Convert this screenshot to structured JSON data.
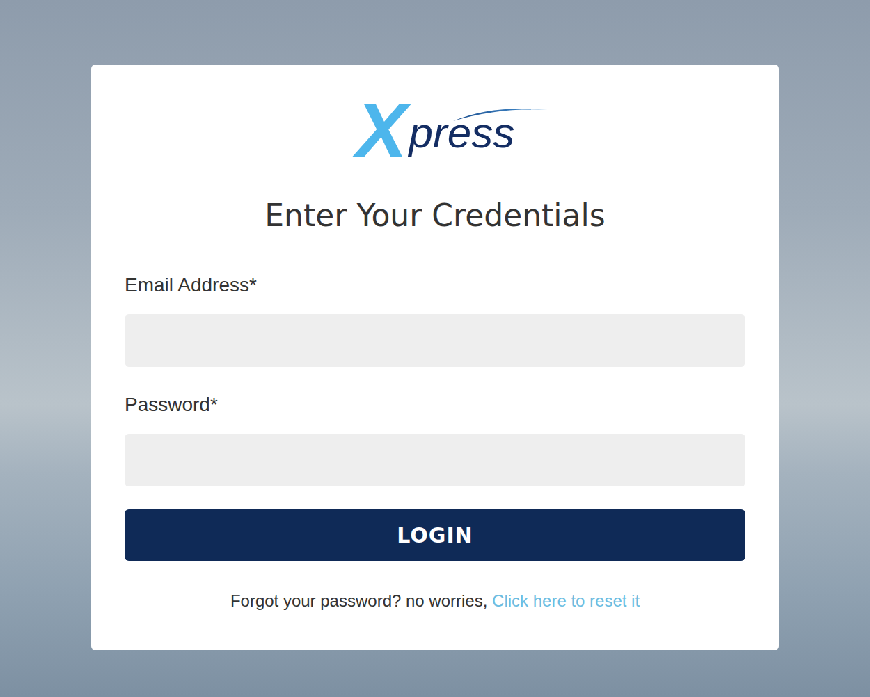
{
  "logo": {
    "mark": "X",
    "text": "press"
  },
  "heading": "Enter Your Credentials",
  "fields": [
    {
      "label": "Email Address*",
      "value": "",
      "kind": "email"
    },
    {
      "label": "Password*",
      "value": "",
      "kind": "password"
    }
  ],
  "button": "LOGIN",
  "footer": {
    "text": "Forgot your password? no worries, ",
    "link": "Click here to reset it"
  }
}
